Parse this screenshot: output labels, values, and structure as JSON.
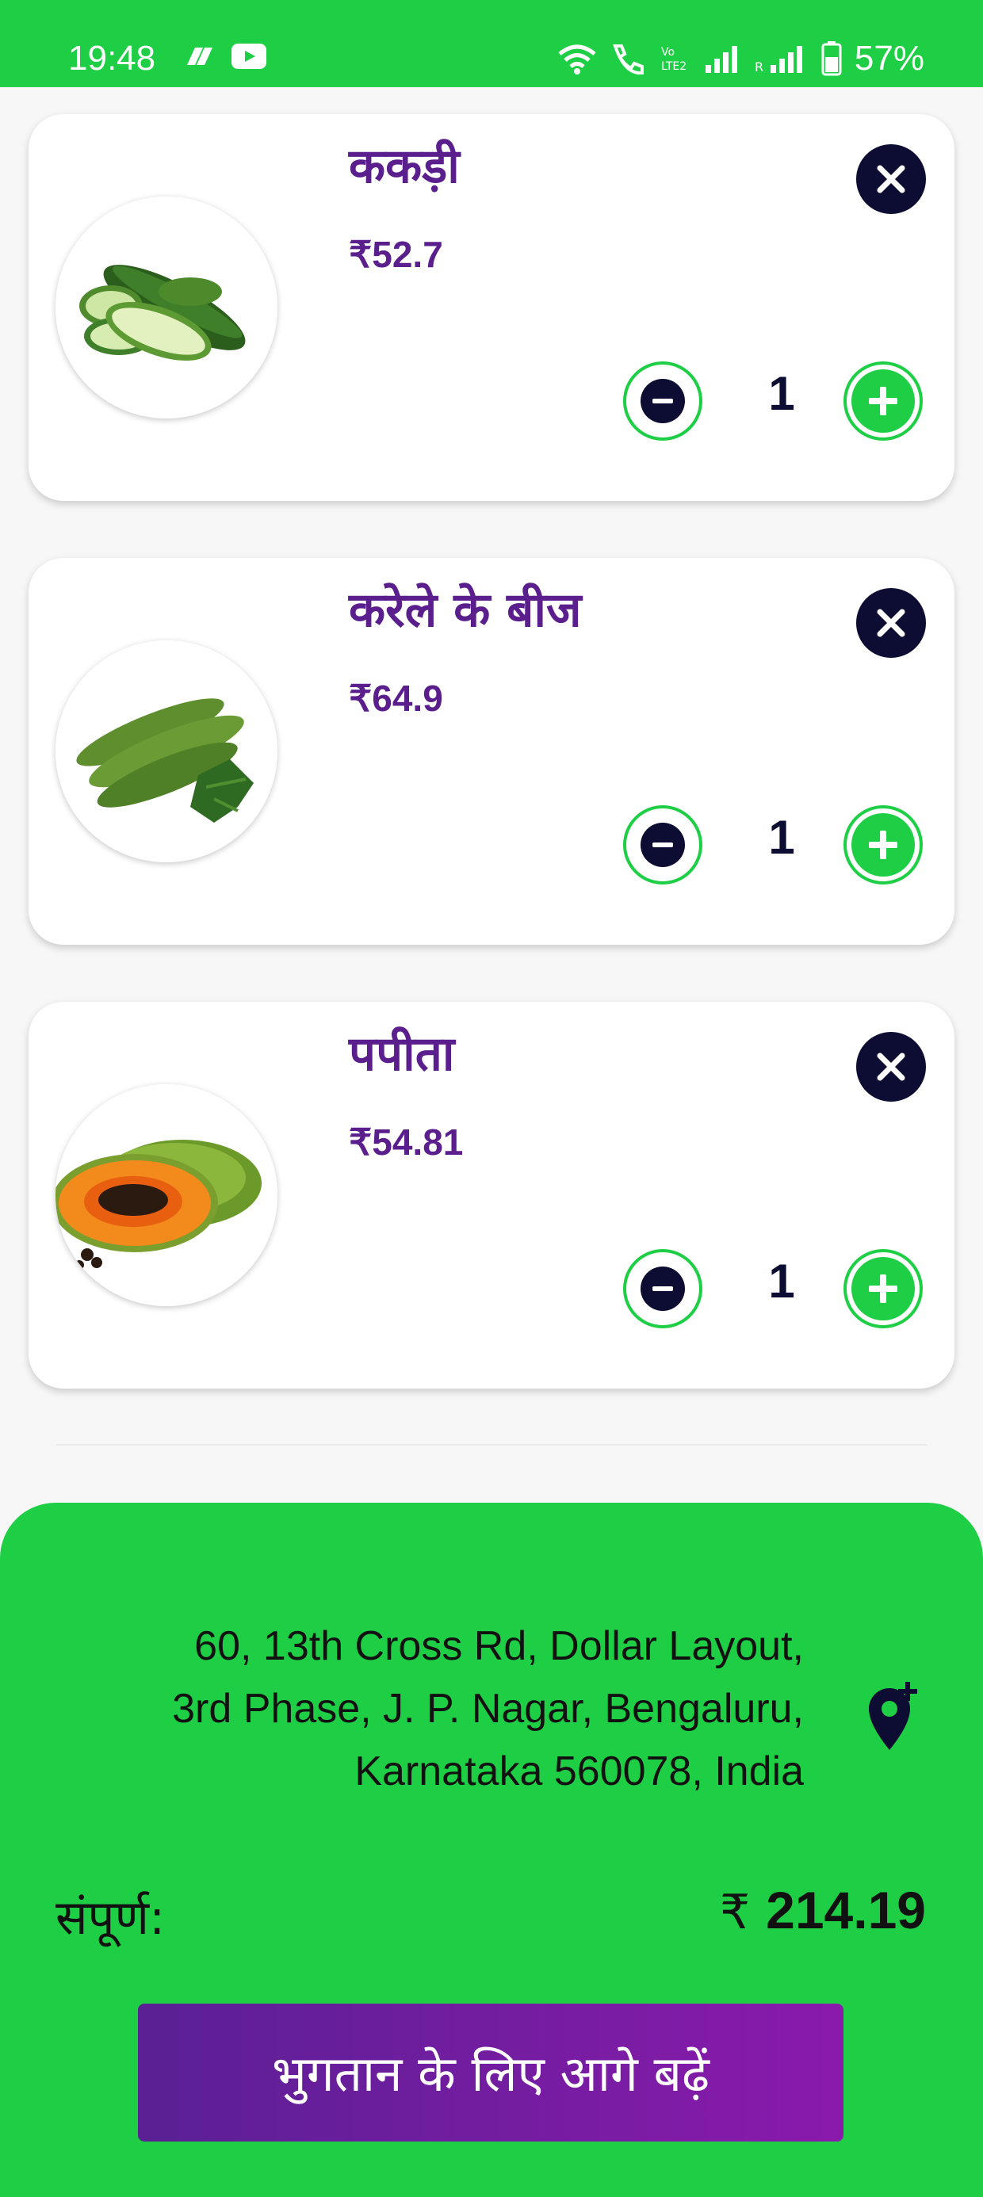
{
  "status_bar": {
    "time": "19:48",
    "battery": "57%"
  },
  "cart": {
    "items": [
      {
        "name": "ककड़ी",
        "price": "₹52.7",
        "quantity": "1",
        "image_icon": "cucumber-image"
      },
      {
        "name": "करेले के बीज",
        "price": "₹64.9",
        "quantity": "1",
        "image_icon": "bitter-gourd-image"
      },
      {
        "name": "पपीता",
        "price": "₹54.81",
        "quantity": "1",
        "image_icon": "papaya-image"
      }
    ]
  },
  "checkout": {
    "address_lines": [
      "60, 13th Cross Rd, Dollar Layout,",
      "3rd Phase, J. P. Nagar, Bengaluru,",
      "Karnataka 560078, India"
    ],
    "total_label": "संपूर्ण:",
    "currency": "₹",
    "total_amount": "214.19",
    "proceed_label": "भुगतान के लिए आगे बढ़ें"
  },
  "colors": {
    "accent_green": "#1ecf45",
    "title_purple": "#5a1f8c",
    "dark_navy": "#0d0c32",
    "button_gradient_start": "#5a2094",
    "button_gradient_end": "#8a1aac"
  }
}
